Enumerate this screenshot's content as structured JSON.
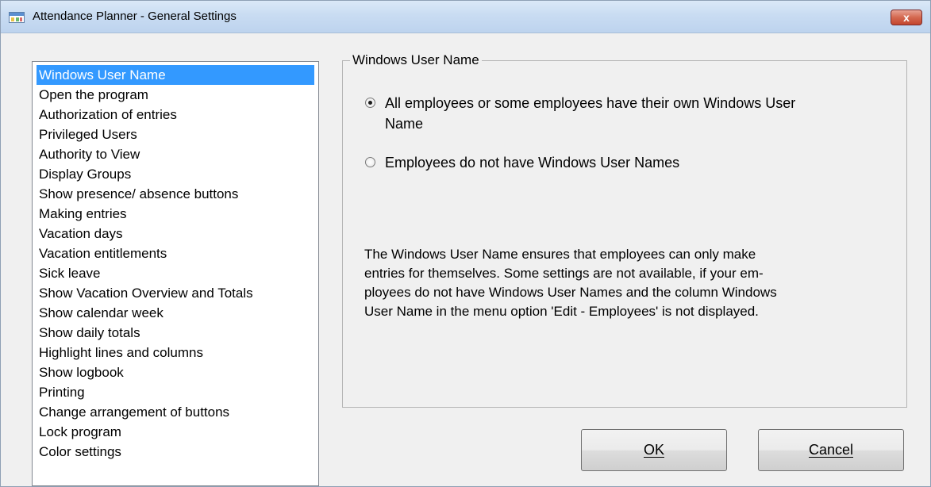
{
  "window": {
    "title": "Attendance Planner - General Settings",
    "close_symbol": "x"
  },
  "sidebar": {
    "items": [
      {
        "label": "Windows User Name",
        "selected": true
      },
      {
        "label": "Open the program"
      },
      {
        "label": "Authorization of entries"
      },
      {
        "label": "Privileged Users"
      },
      {
        "label": "Authority to View"
      },
      {
        "label": "Display Groups"
      },
      {
        "label": "Show presence/ absence buttons"
      },
      {
        "label": "Making entries"
      },
      {
        "label": "Vacation days"
      },
      {
        "label": "Vacation entitlements"
      },
      {
        "label": "Sick leave"
      },
      {
        "label": "Show Vacation Overview and Totals"
      },
      {
        "label": "Show calendar week"
      },
      {
        "label": "Show daily totals"
      },
      {
        "label": "Highlight lines and columns"
      },
      {
        "label": "Show logbook"
      },
      {
        "label": "Printing"
      },
      {
        "label": "Change arrangement of buttons"
      },
      {
        "label": "Lock program"
      },
      {
        "label": "Color settings"
      }
    ]
  },
  "group": {
    "title": "Windows User Name",
    "options": [
      {
        "label_line1": "All employees or some employees have their own Windows User",
        "label_line2": "Name",
        "checked": true
      },
      {
        "label_line1": "Employees do not have Windows User Names",
        "checked": false
      }
    ],
    "info_lines": [
      "The Windows User Name ensures that employees can only make",
      "entries for themselves. Some settings are not available, if your em-",
      "ployees do not have Windows User Names and the column Windows",
      "User Name in the menu option 'Edit - Employees' is not displayed."
    ]
  },
  "buttons": {
    "ok_label": "OK",
    "cancel_label": "Cancel"
  }
}
